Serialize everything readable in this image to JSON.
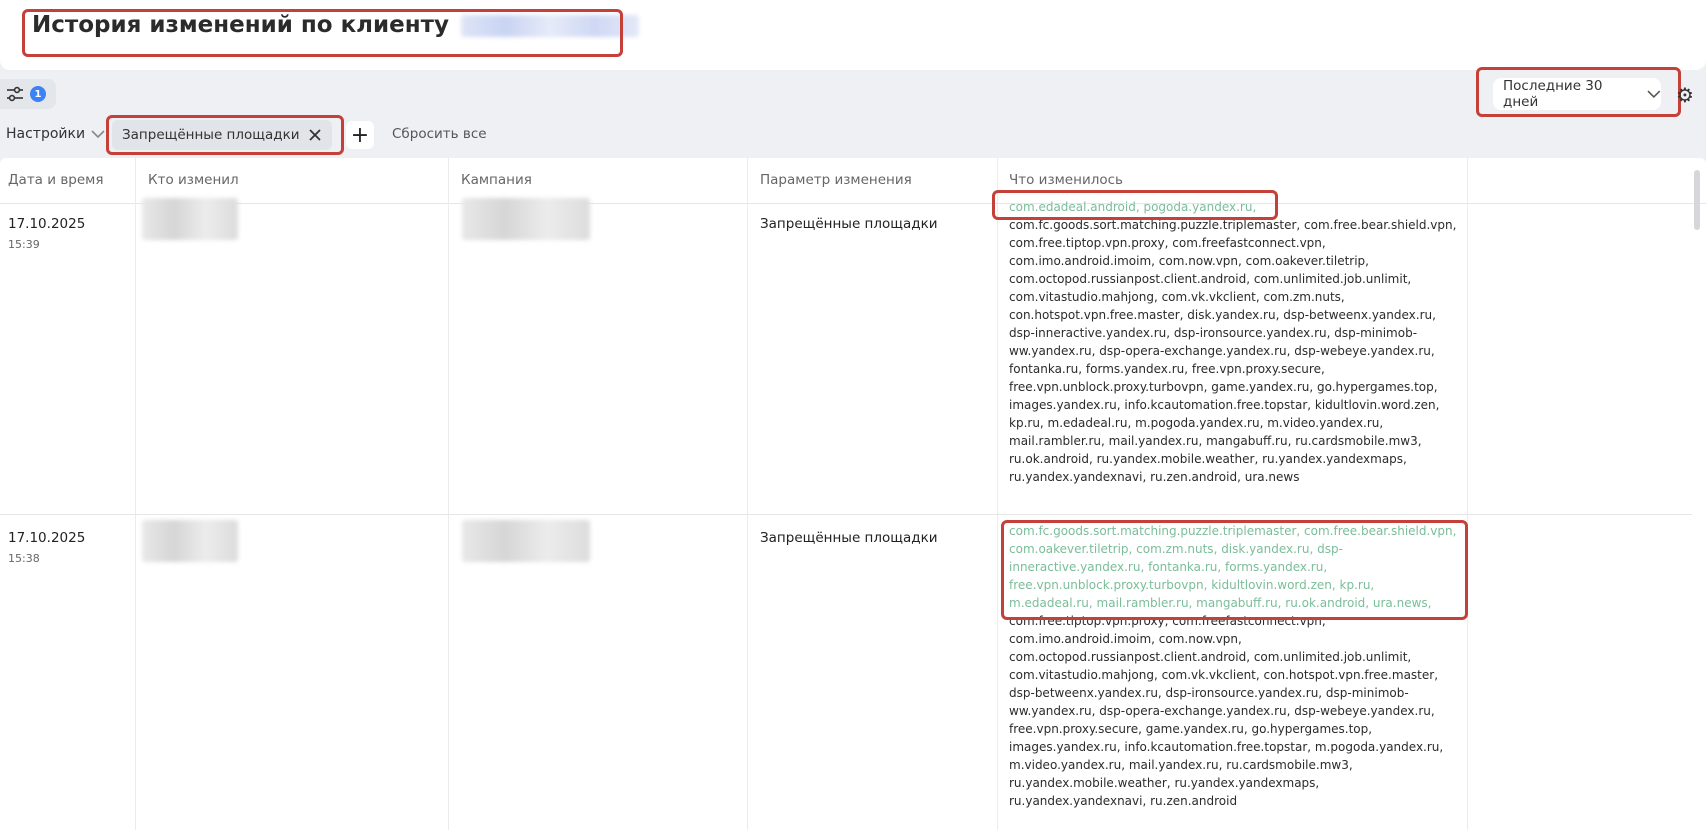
{
  "header": {
    "title": "История изменений  по клиенту"
  },
  "toolbar": {
    "filter_count": "1",
    "period_label": "Последние 30 дней",
    "settings_label": "Настройки",
    "chip_label": "Запрещённые площадки",
    "reset_label": "Сбросить все"
  },
  "table": {
    "columns": [
      "Дата и время",
      "Кто изменил",
      "Кампания",
      "Параметр изменения",
      "Что изменилось"
    ],
    "rows": [
      {
        "date": "17.10.2025",
        "time": "15:39",
        "param": "Запрещённые площадки",
        "added": "com.edadeal.android, pogoda.yandex.ru,",
        "rest": "com.fc.goods.sort.matching.puzzle.triplemaster, com.free.bear.shield.vpn, com.free.tiptop.vpn.proxy, com.freefastconnect.vpn, com.imo.android.imoim, com.now.vpn, com.oakever.tiletrip, com.octopod.russianpost.client.android, com.unlimited.job.unlimit, com.vitastudio.mahjong, com.vk.vkclient, com.zm.nuts, con.hotspot.vpn.free.master, disk.yandex.ru, dsp-betweenx.yandex.ru, dsp-inneractive.yandex.ru, dsp-ironsource.yandex.ru, dsp-minimob-ww.yandex.ru, dsp-opera-exchange.yandex.ru, dsp-webeye.yandex.ru, fontanka.ru, forms.yandex.ru, free.vpn.proxy.secure, free.vpn.unblock.proxy.turbovpn, game.yandex.ru, go.hypergames.top, images.yandex.ru, info.kcautomation.free.topstar, kidultlovin.word.zen, kp.ru, m.edadeal.ru, m.pogoda.yandex.ru, m.video.yandex.ru, mail.rambler.ru, mail.yandex.ru, mangabuff.ru, ru.cardsmobile.mw3, ru.ok.android, ru.yandex.mobile.weather, ru.yandex.yandexmaps, ru.yandex.yandexnavi, ru.zen.android, ura.news"
      },
      {
        "date": "17.10.2025",
        "time": "15:38",
        "param": "Запрещённые площадки",
        "added": "com.fc.goods.sort.matching.puzzle.triplemaster, com.free.bear.shield.vpn, com.oakever.tiletrip, com.zm.nuts, disk.yandex.ru, dsp-inneractive.yandex.ru, fontanka.ru, forms.yandex.ru, free.vpn.unblock.proxy.turbovpn, kidultlovin.word.zen, kp.ru, m.edadeal.ru, mail.rambler.ru, mangabuff.ru, ru.ok.android, ura.news,",
        "rest": "com.free.tiptop.vpn.proxy, com.freefastconnect.vpn, com.imo.android.imoim, com.now.vpn, com.octopod.russianpost.client.android, com.unlimited.job.unlimit, com.vitastudio.mahjong, com.vk.vkclient, con.hotspot.vpn.free.master, dsp-betweenx.yandex.ru, dsp-ironsource.yandex.ru, dsp-minimob-ww.yandex.ru, dsp-opera-exchange.yandex.ru, dsp-webeye.yandex.ru, free.vpn.proxy.secure, game.yandex.ru, go.hypergames.top, images.yandex.ru, info.kcautomation.free.topstar, m.pogoda.yandex.ru, m.video.yandex.ru, mail.yandex.ru, ru.cardsmobile.mw3, ru.yandex.mobile.weather, ru.yandex.yandexmaps, ru.yandex.yandexnavi, ru.zen.android"
      }
    ]
  }
}
